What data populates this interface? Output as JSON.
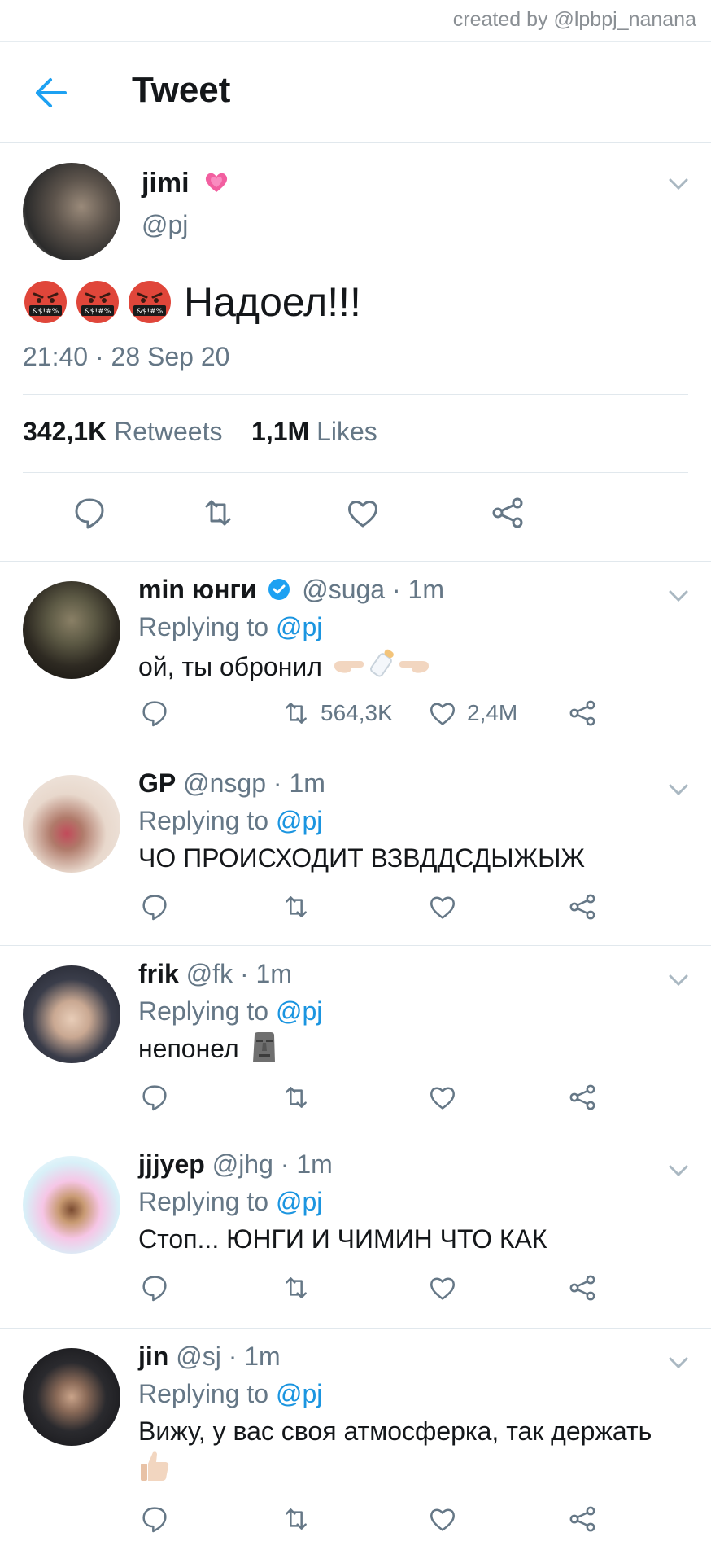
{
  "credit": "created by @lpbpj_nanana",
  "header": {
    "title": "Tweet"
  },
  "colors": {
    "accent": "#1b95e0",
    "secondary_text": "#657786",
    "divider": "#e1e8ed"
  },
  "main_tweet": {
    "name": "jimi",
    "handle": "@pj",
    "text": "Надоел!!!",
    "emoji_prefix": [
      "angry-cursing-face",
      "angry-cursing-face",
      "angry-cursing-face"
    ],
    "time": "21:40 · 28 Sep 20",
    "retweets_count": "342,1K",
    "retweets_label": "Retweets",
    "likes_count": "1,1M",
    "likes_label": "Likes"
  },
  "replies": [
    {
      "name": "min юнги",
      "verified": true,
      "handle": "@suga",
      "time": "· 1m",
      "replying_prefix": "Replying to",
      "replying_to": "@pj",
      "text": "ой, ты обронил",
      "emoji_suffix": "pointing-hands-baby-bottle",
      "retweets": "564,3K",
      "likes": "2,4M"
    },
    {
      "name": "GP",
      "verified": false,
      "handle": "@nsgp",
      "time": "· 1m",
      "replying_prefix": "Replying to",
      "replying_to": "@pj",
      "text": "ЧО ПРОИСХОДИТ ВЗВДДСДЫЖЫЖ",
      "retweets": "",
      "likes": ""
    },
    {
      "name": "frik",
      "verified": false,
      "handle": "@fk",
      "time": "· 1m",
      "replying_prefix": "Replying to",
      "replying_to": "@pj",
      "text": "непонел",
      "emoji_suffix": "moai",
      "retweets": "",
      "likes": ""
    },
    {
      "name": "jjjyep",
      "verified": false,
      "handle": "@jhg",
      "time": "· 1m",
      "replying_prefix": "Replying to",
      "replying_to": "@pj",
      "text": "Стоп... ЮНГИ И ЧИМИН ЧТО КАК",
      "retweets": "",
      "likes": ""
    },
    {
      "name": "jin",
      "verified": false,
      "handle": "@sj",
      "time": "· 1m",
      "replying_prefix": "Replying to",
      "replying_to": "@pj",
      "text": "Вижу, у вас своя атмосферка, так держать",
      "emoji_suffix": "thumbs-up",
      "retweets": "",
      "likes": ""
    }
  ]
}
